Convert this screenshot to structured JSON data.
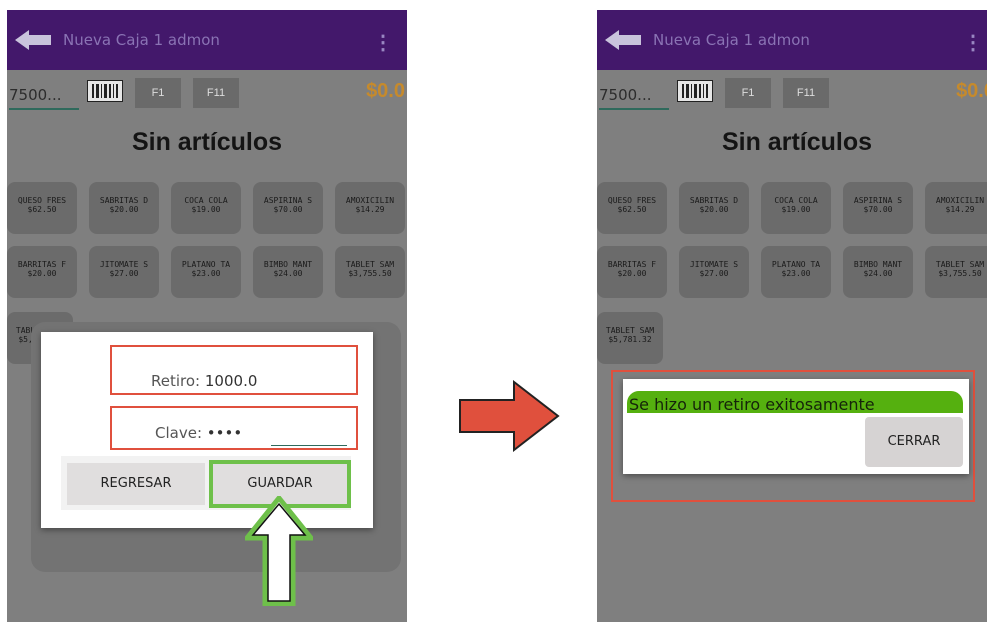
{
  "app": {
    "title": "Nueva Caja 1 admon",
    "search_value": "7500...",
    "key_f1": "F1",
    "key_f11": "F11",
    "total": "$0.0",
    "empty_heading": "Sin artículos"
  },
  "products": [
    {
      "name": "QUESO FRES",
      "price": "$62.50"
    },
    {
      "name": "SABRITAS D",
      "price": "$20.00"
    },
    {
      "name": "COCA COLA",
      "price": "$19.00"
    },
    {
      "name": "ASPIRINA S",
      "price": "$70.00"
    },
    {
      "name": "AMOXICILIN",
      "price": "$14.29"
    },
    {
      "name": "BARRITAS F",
      "price": "$20.00"
    },
    {
      "name": "JITOMATE S",
      "price": "$27.00"
    },
    {
      "name": "PLATANO TA",
      "price": "$23.00"
    },
    {
      "name": "BIMBO MANT",
      "price": "$24.00"
    },
    {
      "name": "TABLET SAM",
      "price": "$3,755.50"
    },
    {
      "name": "TABLET SAM",
      "price": "$5,781.32"
    }
  ],
  "withdraw_dialog": {
    "retiro_label": "Retiro:",
    "retiro_value": "1000.0",
    "clave_label": "Clave:",
    "clave_value": "••••",
    "back_button": "REGRESAR",
    "save_button": "GUARDAR"
  },
  "success_dialog": {
    "message": "Se hizo un retiro exitosamente",
    "close_button": "CERRAR"
  },
  "colors": {
    "appbar": "#43186b",
    "highlight_red": "#e0503d",
    "highlight_green": "#6ec04a",
    "success_bar": "#55b00f",
    "total_color": "#c68a2c"
  }
}
